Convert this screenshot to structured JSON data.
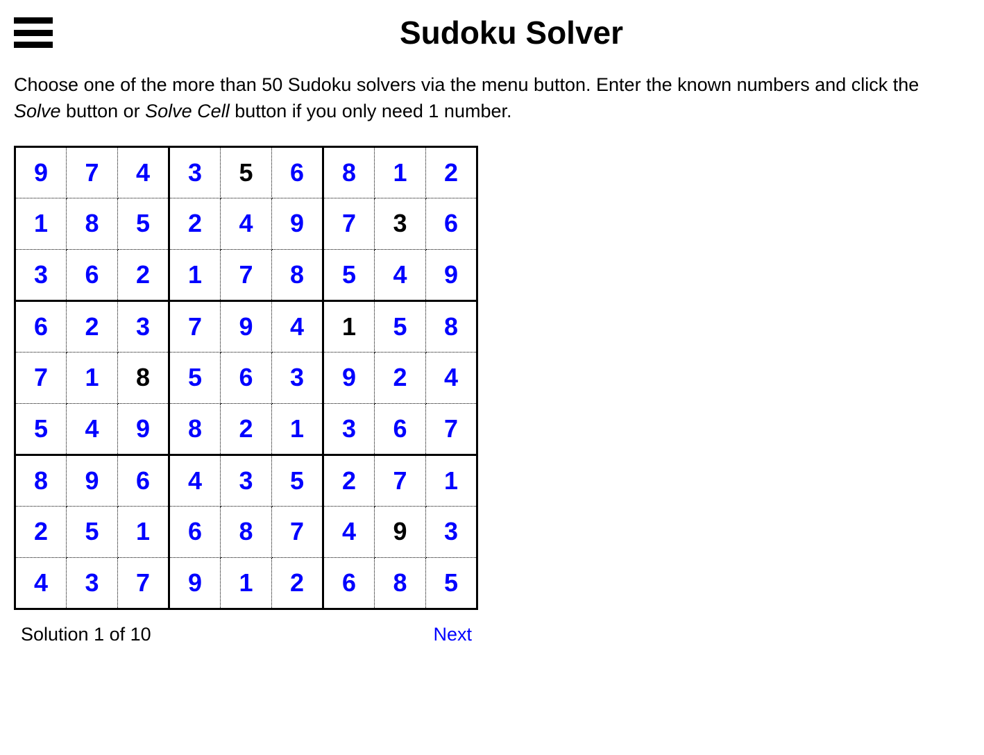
{
  "header": {
    "title": "Sudoku Solver"
  },
  "instructions": {
    "part1": "Choose one of the more than 50 Sudoku solvers via the menu button. Enter the known numbers and click the ",
    "solve": "Solve",
    "part2": " button or ",
    "solvecell": "Solve Cell",
    "part3": " button if you only need 1 number."
  },
  "grid": [
    [
      {
        "v": "9",
        "t": "solved"
      },
      {
        "v": "7",
        "t": "solved"
      },
      {
        "v": "4",
        "t": "solved"
      },
      {
        "v": "3",
        "t": "solved"
      },
      {
        "v": "5",
        "t": "given"
      },
      {
        "v": "6",
        "t": "solved"
      },
      {
        "v": "8",
        "t": "solved"
      },
      {
        "v": "1",
        "t": "solved"
      },
      {
        "v": "2",
        "t": "solved"
      }
    ],
    [
      {
        "v": "1",
        "t": "solved"
      },
      {
        "v": "8",
        "t": "solved"
      },
      {
        "v": "5",
        "t": "solved"
      },
      {
        "v": "2",
        "t": "solved"
      },
      {
        "v": "4",
        "t": "solved"
      },
      {
        "v": "9",
        "t": "solved"
      },
      {
        "v": "7",
        "t": "solved"
      },
      {
        "v": "3",
        "t": "given"
      },
      {
        "v": "6",
        "t": "solved"
      }
    ],
    [
      {
        "v": "3",
        "t": "solved"
      },
      {
        "v": "6",
        "t": "solved"
      },
      {
        "v": "2",
        "t": "solved"
      },
      {
        "v": "1",
        "t": "solved"
      },
      {
        "v": "7",
        "t": "solved"
      },
      {
        "v": "8",
        "t": "solved"
      },
      {
        "v": "5",
        "t": "solved"
      },
      {
        "v": "4",
        "t": "solved"
      },
      {
        "v": "9",
        "t": "solved"
      }
    ],
    [
      {
        "v": "6",
        "t": "solved"
      },
      {
        "v": "2",
        "t": "solved"
      },
      {
        "v": "3",
        "t": "solved"
      },
      {
        "v": "7",
        "t": "solved"
      },
      {
        "v": "9",
        "t": "solved"
      },
      {
        "v": "4",
        "t": "solved"
      },
      {
        "v": "1",
        "t": "given"
      },
      {
        "v": "5",
        "t": "solved"
      },
      {
        "v": "8",
        "t": "solved"
      }
    ],
    [
      {
        "v": "7",
        "t": "solved"
      },
      {
        "v": "1",
        "t": "solved"
      },
      {
        "v": "8",
        "t": "given"
      },
      {
        "v": "5",
        "t": "solved"
      },
      {
        "v": "6",
        "t": "solved"
      },
      {
        "v": "3",
        "t": "solved"
      },
      {
        "v": "9",
        "t": "solved"
      },
      {
        "v": "2",
        "t": "solved"
      },
      {
        "v": "4",
        "t": "solved"
      }
    ],
    [
      {
        "v": "5",
        "t": "solved"
      },
      {
        "v": "4",
        "t": "solved"
      },
      {
        "v": "9",
        "t": "solved"
      },
      {
        "v": "8",
        "t": "solved"
      },
      {
        "v": "2",
        "t": "solved"
      },
      {
        "v": "1",
        "t": "solved"
      },
      {
        "v": "3",
        "t": "solved"
      },
      {
        "v": "6",
        "t": "solved"
      },
      {
        "v": "7",
        "t": "solved"
      }
    ],
    [
      {
        "v": "8",
        "t": "solved"
      },
      {
        "v": "9",
        "t": "solved"
      },
      {
        "v": "6",
        "t": "solved"
      },
      {
        "v": "4",
        "t": "solved"
      },
      {
        "v": "3",
        "t": "solved"
      },
      {
        "v": "5",
        "t": "solved"
      },
      {
        "v": "2",
        "t": "solved"
      },
      {
        "v": "7",
        "t": "solved"
      },
      {
        "v": "1",
        "t": "solved"
      }
    ],
    [
      {
        "v": "2",
        "t": "solved"
      },
      {
        "v": "5",
        "t": "solved"
      },
      {
        "v": "1",
        "t": "solved"
      },
      {
        "v": "6",
        "t": "solved"
      },
      {
        "v": "8",
        "t": "solved"
      },
      {
        "v": "7",
        "t": "solved"
      },
      {
        "v": "4",
        "t": "solved"
      },
      {
        "v": "9",
        "t": "given"
      },
      {
        "v": "3",
        "t": "solved"
      }
    ],
    [
      {
        "v": "4",
        "t": "solved"
      },
      {
        "v": "3",
        "t": "solved"
      },
      {
        "v": "7",
        "t": "solved"
      },
      {
        "v": "9",
        "t": "solved"
      },
      {
        "v": "1",
        "t": "solved"
      },
      {
        "v": "2",
        "t": "solved"
      },
      {
        "v": "6",
        "t": "solved"
      },
      {
        "v": "8",
        "t": "solved"
      },
      {
        "v": "5",
        "t": "solved"
      }
    ]
  ],
  "footer": {
    "solution_label": "Solution 1 of 10",
    "next_label": "Next"
  }
}
